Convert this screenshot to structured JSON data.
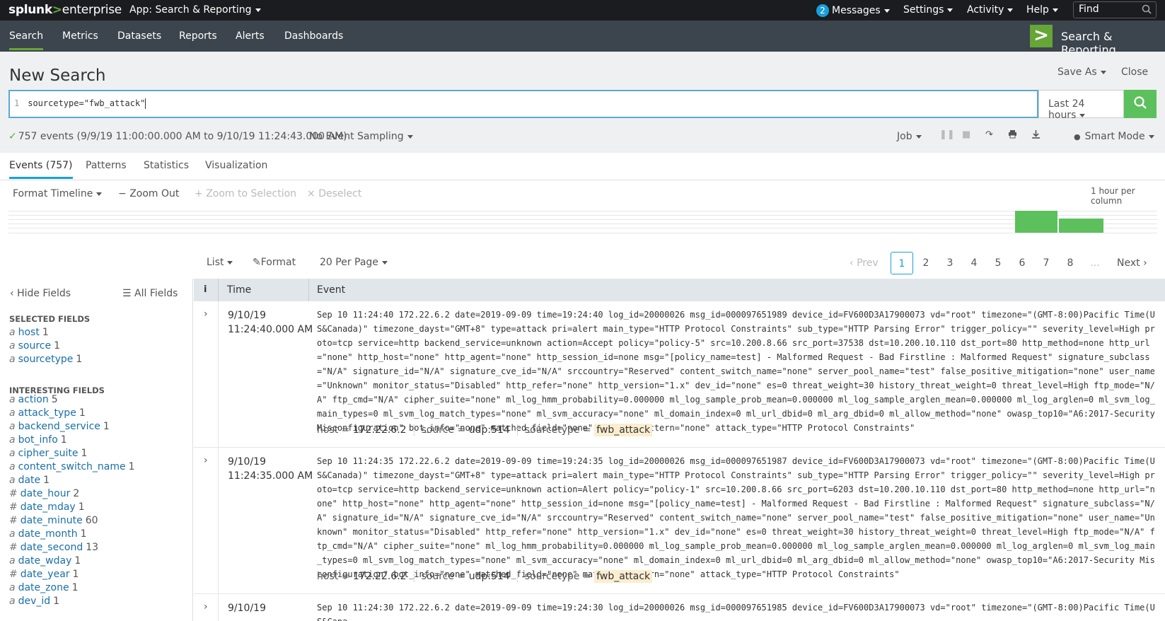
{
  "brand": {
    "bold": "splunk",
    "gt": ">",
    "rest": "enterprise"
  },
  "topbar": {
    "app_menu": "App: Search & Reporting",
    "messages_count": "2",
    "messages": "Messages",
    "settings": "Settings",
    "activity": "Activity",
    "help": "Help",
    "find_placeholder": "Find"
  },
  "nav": {
    "items": [
      "Search",
      "Metrics",
      "Datasets",
      "Reports",
      "Alerts",
      "Dashboards"
    ],
    "app_name": "Search & Reporting",
    "app_logo": ">"
  },
  "search": {
    "title": "New Search",
    "save_as": "Save As",
    "close": "Close",
    "line_number": "1",
    "query": "sourcetype=\"fwb_attack\"",
    "time_range": "Last 24 hours"
  },
  "status": {
    "events": "757 events (9/9/19 11:00:00.000 AM to 9/10/19 11:24:43.000 AM)",
    "sampling": "No Event Sampling",
    "job": "Job",
    "mode": "Smart Mode"
  },
  "tabs": [
    "Events (757)",
    "Patterns",
    "Statistics",
    "Visualization"
  ],
  "timeline": {
    "format": "Format Timeline",
    "zoom_out": "Zoom Out",
    "zoom_sel": "Zoom to Selection",
    "deselect": "Deselect",
    "per_column": "1 hour per column",
    "bins": [
      {
        "height": 1.0
      },
      {
        "height": 0.63
      }
    ]
  },
  "controls": {
    "list": "List",
    "format": "Format",
    "per_page": "20 Per Page",
    "prev": "Prev",
    "pages": [
      "1",
      "2",
      "3",
      "4",
      "5",
      "6",
      "7",
      "8"
    ],
    "ellipsis": "...",
    "next": "Next"
  },
  "sidebar": {
    "hide": "Hide Fields",
    "all": "All Fields",
    "selected_title": "SELECTED FIELDS",
    "selected": [
      {
        "t": "a",
        "name": "host",
        "count": "1"
      },
      {
        "t": "a",
        "name": "source",
        "count": "1"
      },
      {
        "t": "a",
        "name": "sourcetype",
        "count": "1"
      }
    ],
    "interesting_title": "INTERESTING FIELDS",
    "interesting": [
      {
        "t": "a",
        "name": "action",
        "count": "5"
      },
      {
        "t": "a",
        "name": "attack_type",
        "count": "1"
      },
      {
        "t": "a",
        "name": "backend_service",
        "count": "1"
      },
      {
        "t": "a",
        "name": "bot_info",
        "count": "1"
      },
      {
        "t": "a",
        "name": "cipher_suite",
        "count": "1"
      },
      {
        "t": "a",
        "name": "content_switch_name",
        "count": "1"
      },
      {
        "t": "a",
        "name": "date",
        "count": "1"
      },
      {
        "t": "#",
        "name": "date_hour",
        "count": "2"
      },
      {
        "t": "#",
        "name": "date_mday",
        "count": "1"
      },
      {
        "t": "#",
        "name": "date_minute",
        "count": "60"
      },
      {
        "t": "a",
        "name": "date_month",
        "count": "1"
      },
      {
        "t": "#",
        "name": "date_second",
        "count": "13"
      },
      {
        "t": "a",
        "name": "date_wday",
        "count": "1"
      },
      {
        "t": "#",
        "name": "date_year",
        "count": "1"
      },
      {
        "t": "a",
        "name": "date_zone",
        "count": "1"
      },
      {
        "t": "a",
        "name": "dev_id",
        "count": "1"
      }
    ]
  },
  "table": {
    "head_i": "i",
    "head_time": "Time",
    "head_event": "Event"
  },
  "events": [
    {
      "date": "9/10/19",
      "time": "11:24:40.000 AM",
      "raw": "Sep 10 11:24:40 172.22.6.2 date=2019-09-09 time=19:24:40 log_id=20000026 msg_id=000097651989 device_id=FV600D3A17900073 vd=\"root\" timezone=\"(GMT-8:00)Pacific Time(US&Canada)\" timezone_dayst=\"GMT+8\" type=attack pri=alert main_type=\"HTTP Protocol Constraints\" sub_type=\"HTTP Parsing Error\" trigger_policy=\"\" severity_level=High proto=tcp service=http backend_service=unknown action=Accept policy=\"policy-5\" src=10.200.8.66 src_port=37538 dst=10.200.10.110 dst_port=80 http_method=none http_url=\"none\" http_host=\"none\" http_agent=\"none\" http_session_id=none msg=\"[policy_name=test] - Malformed Request - Bad Firstline : Malformed Request\" signature_subclass=\"N/A\" signature_id=\"N/A\" signature_cve_id=\"N/A\" srccountry=\"Reserved\" content_switch_name=\"none\" server_pool_name=\"test\" false_positive_mitigation=\"none\" user_name=\"Unknown\" monitor_status=\"Disabled\" http_refer=\"none\" http_version=\"1.x\" dev_id=\"none\" es=0 threat_weight=30 history_threat_weight=0 threat_level=High ftp_mode=\"N/A\" ftp_cmd=\"N/A\" cipher_suite=\"none\" ml_log_hmm_probability=0.000000 ml_log_sample_prob_mean=0.000000 ml_log_sample_arglen_mean=0.000000 ml_log_arglen=0 ml_svm_log_main_types=0 ml_svm_log_match_types=\"none\" ml_svm_accuracy=\"none\" ml_domain_index=0 ml_url_dbid=0 ml_arg_dbid=0 ml_allow_method=\"none\" owasp_top10=\"A6:2017-Security Misconfiguration\" bot_info=\"none\" matched_field=\"none\" matched_pattern=\"none\" attack_type=\"HTTP Protocol Constraints\"",
      "host_k": "host =",
      "host": "172.22.6.2",
      "source_k": "source =",
      "source": "udp:514",
      "st_k": "sourcetype =",
      "sourcetype": "fwb_attack"
    },
    {
      "date": "9/10/19",
      "time": "11:24:35.000 AM",
      "raw": "Sep 10 11:24:35 172.22.6.2 date=2019-09-09 time=19:24:35 log_id=20000026 msg_id=000097651987 device_id=FV600D3A17900073 vd=\"root\" timezone=\"(GMT-8:00)Pacific Time(US&Canada)\" timezone_dayst=\"GMT+8\" type=attack pri=alert main_type=\"HTTP Protocol Constraints\" sub_type=\"HTTP Parsing Error\" trigger_policy=\"\" severity_level=High proto=tcp service=http backend_service=unknown action=Alert policy=\"policy-1\" src=10.200.8.66 src_port=6203 dst=10.200.10.110 dst_port=80 http_method=none http_url=\"none\" http_host=\"none\" http_agent=\"none\" http_session_id=none msg=\"[policy_name=test] - Malformed Request - Bad Firstline : Malformed Request\" signature_subclass=\"N/A\" signature_id=\"N/A\" signature_cve_id=\"N/A\" srccountry=\"Reserved\" content_switch_name=\"none\" server_pool_name=\"test\" false_positive_mitigation=\"none\" user_name=\"Unknown\" monitor_status=\"Disabled\" http_refer=\"none\" http_version=\"1.x\" dev_id=\"none\" es=0 threat_weight=30 history_threat_weight=0 threat_level=High ftp_mode=\"N/A\" ftp_cmd=\"N/A\" cipher_suite=\"none\" ml_log_hmm_probability=0.000000 ml_log_sample_prob_mean=0.000000 ml_log_sample_arglen_mean=0.000000 ml_log_arglen=0 ml_svm_log_main_types=0 ml_svm_log_match_types=\"none\" ml_svm_accuracy=\"none\" ml_domain_index=0 ml_url_dbid=0 ml_arg_dbid=0 ml_allow_method=\"none\" owasp_top10=\"A6:2017-Security Misconfiguration\" bot_info=\"none\" matched_field=\"none\" matched_pattern=\"none\" attack_type=\"HTTP Protocol Constraints\"",
      "host_k": "host =",
      "host": "172.22.6.2",
      "source_k": "source =",
      "source": "udp:514",
      "st_k": "sourcetype =",
      "sourcetype": "fwb_attack"
    },
    {
      "date": "9/10/19",
      "raw": "Sep 10 11:24:30 172.22.6.2 date=2019-09-09 time=19:24:30 log_id=20000026 msg_id=000097651985 device_id=FV600D3A17900073 vd=\"root\" timezone=\"(GMT-8:00)Pacific Time(US&Cana"
    }
  ],
  "colors": {
    "green": "#5cc05c",
    "blue": "#1a9fda",
    "topbar": "#1a1c20",
    "navbar": "#3c444d"
  }
}
